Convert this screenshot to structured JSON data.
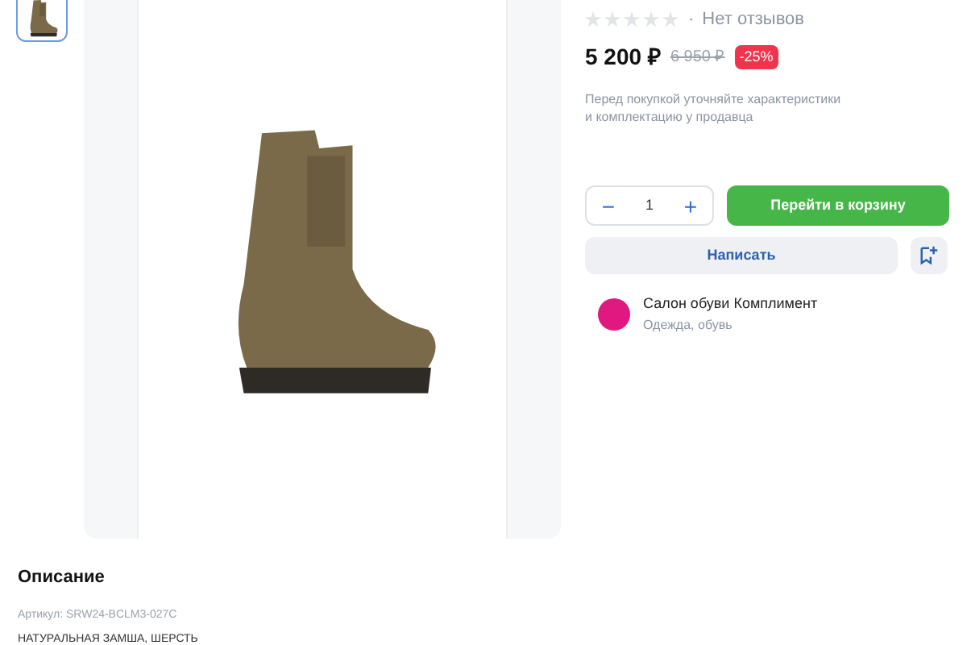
{
  "gallery": {
    "thumbnails": [
      {
        "selected": true
      }
    ]
  },
  "product": {
    "rating": {
      "stars": 0,
      "separator": "·",
      "reviews": "Нет отзывов"
    },
    "price": "5 200 ₽",
    "old_price": "6 950 ₽",
    "discount": "-25%",
    "note": "Перед покупкой уточняйте характеристики и комплектацию у продавца",
    "quantity": "1",
    "qty_minus": "−",
    "qty_plus": "+",
    "cart_button": "Перейти в корзину",
    "write_button": "Написать"
  },
  "seller": {
    "name": "Салон обуви Комплимент",
    "category": "Одежда, обувь"
  },
  "description": {
    "title": "Описание",
    "article": "Артикул: SRW24-BCLM3-027C",
    "text": "НАТУРАЛЬНАЯ ЗАМША, ШЕРСТЬ"
  }
}
